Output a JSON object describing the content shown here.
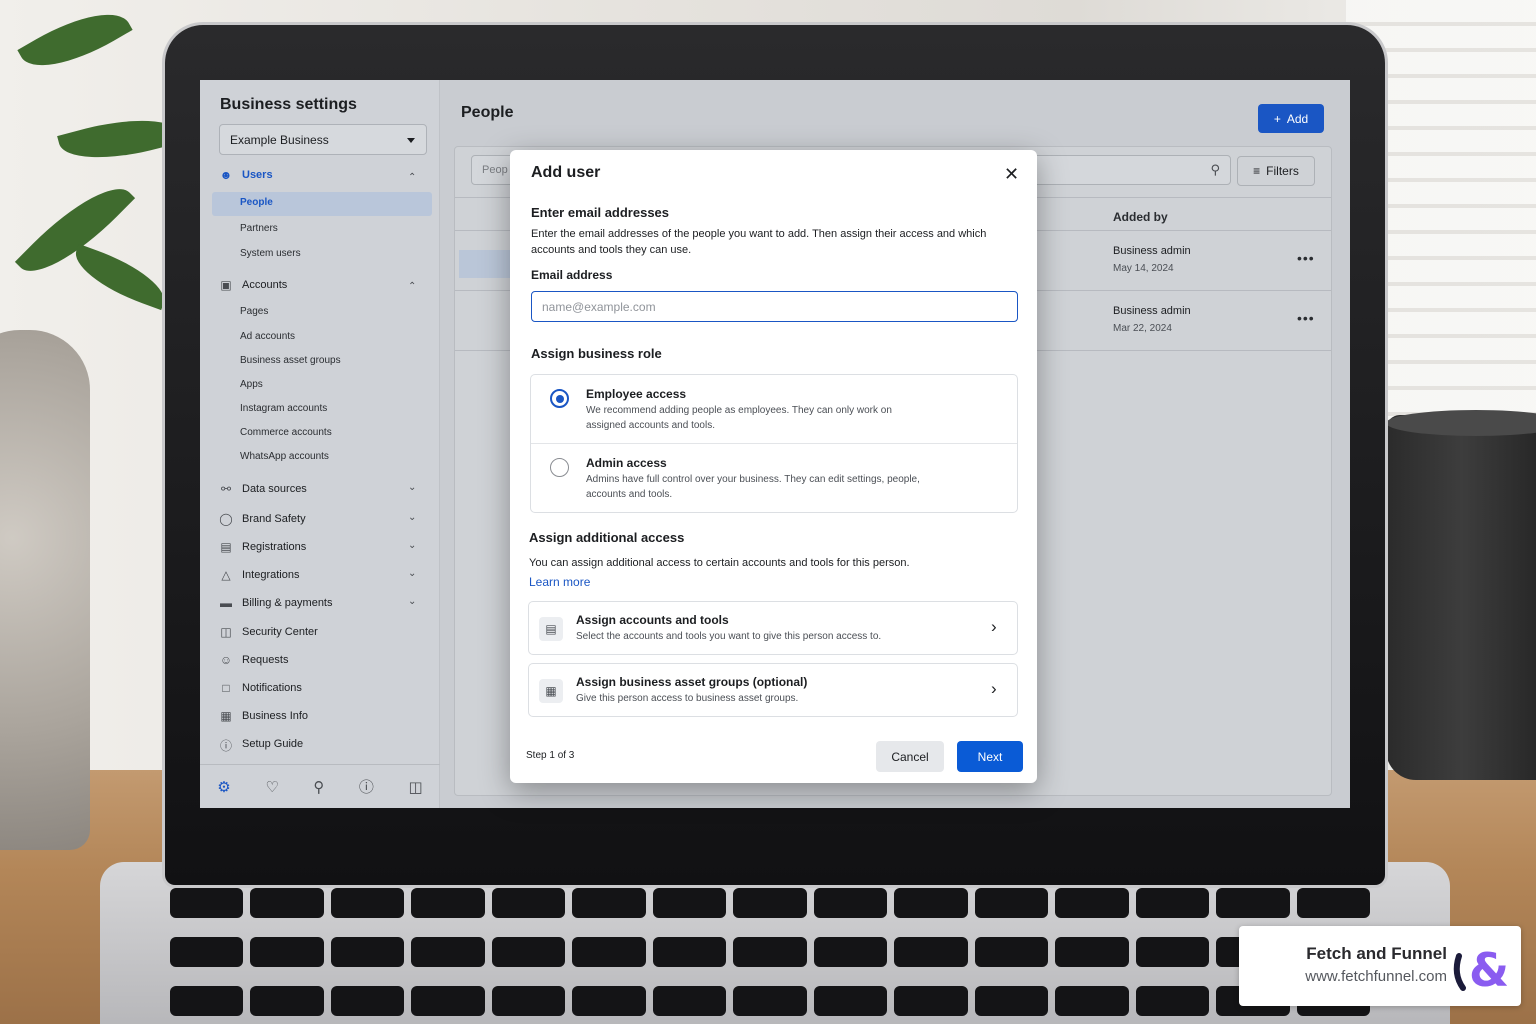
{
  "sidebar": {
    "title": "Business settings",
    "business_select": "Example Business",
    "sections": [
      {
        "label": "Users",
        "icon": "users-icon"
      },
      {
        "label": "Accounts",
        "icon": "briefcase-icon"
      },
      {
        "label": "Data sources",
        "icon": "data-sources-icon"
      },
      {
        "label": "Brand Safety",
        "icon": "shield-icon"
      },
      {
        "label": "Registrations",
        "icon": "registrations-icon"
      },
      {
        "label": "Integrations",
        "icon": "integrations-icon"
      },
      {
        "label": "Billing & payments",
        "icon": "credit-card-icon"
      },
      {
        "label": "Security Center",
        "icon": "lock-icon"
      },
      {
        "label": "Requests",
        "icon": "person-request-icon"
      },
      {
        "label": "Notifications",
        "icon": "notifications-icon"
      },
      {
        "label": "Business Info",
        "icon": "building-icon"
      },
      {
        "label": "Setup Guide",
        "icon": "question-icon"
      }
    ],
    "users_items": [
      "People",
      "Partners",
      "System users"
    ],
    "accounts_items": [
      "Pages",
      "Ad accounts",
      "Business asset groups",
      "Apps",
      "Instagram accounts",
      "Commerce accounts",
      "WhatsApp accounts"
    ],
    "bottom_icons": [
      "settings-gear-icon",
      "bell-icon",
      "search-icon",
      "help-icon",
      "panel-icon"
    ]
  },
  "main": {
    "title": "People",
    "add_button": "Add",
    "search_placeholder": "Peop",
    "filters_button": "Filters",
    "column_added_by": "Added by",
    "rows": [
      {
        "added_by": "Business admin",
        "date": "May 14, 2024"
      },
      {
        "added_by": "Business admin",
        "date": "Mar 22, 2024"
      }
    ]
  },
  "modal": {
    "title": "Add user",
    "email_heading": "Enter email addresses",
    "email_desc": "Enter the email addresses of the people you want to add. Then assign their access and which accounts and tools they can use.",
    "email_label": "Email address",
    "email_placeholder": "name@example.com",
    "email_value": "",
    "role_heading": "Assign business role",
    "roles": [
      {
        "name": "Employee access",
        "desc": "We recommend adding people as employees. They can only work on assigned accounts and tools.",
        "selected": true
      },
      {
        "name": "Admin access",
        "desc": "Admins have full control over your business. They can edit settings, people, accounts and tools.",
        "selected": false
      }
    ],
    "additional_heading": "Assign additional access",
    "additional_desc": "You can assign additional access to certain accounts and tools for this person.",
    "learn_more": "Learn more",
    "cards": [
      {
        "title": "Assign accounts and tools",
        "desc": "Select the accounts and tools you want to give this person access to."
      },
      {
        "title": "Assign business asset groups (optional)",
        "desc": "Give this person access to business asset groups."
      }
    ],
    "step": "Step 1 of 3",
    "cancel": "Cancel",
    "next": "Next"
  },
  "watermark": {
    "name": "Fetch and Funnel",
    "url": "www.fetchfunnel.com"
  },
  "colors": {
    "accent": "#1a56c4",
    "primary_button": "#0a5bd6"
  }
}
